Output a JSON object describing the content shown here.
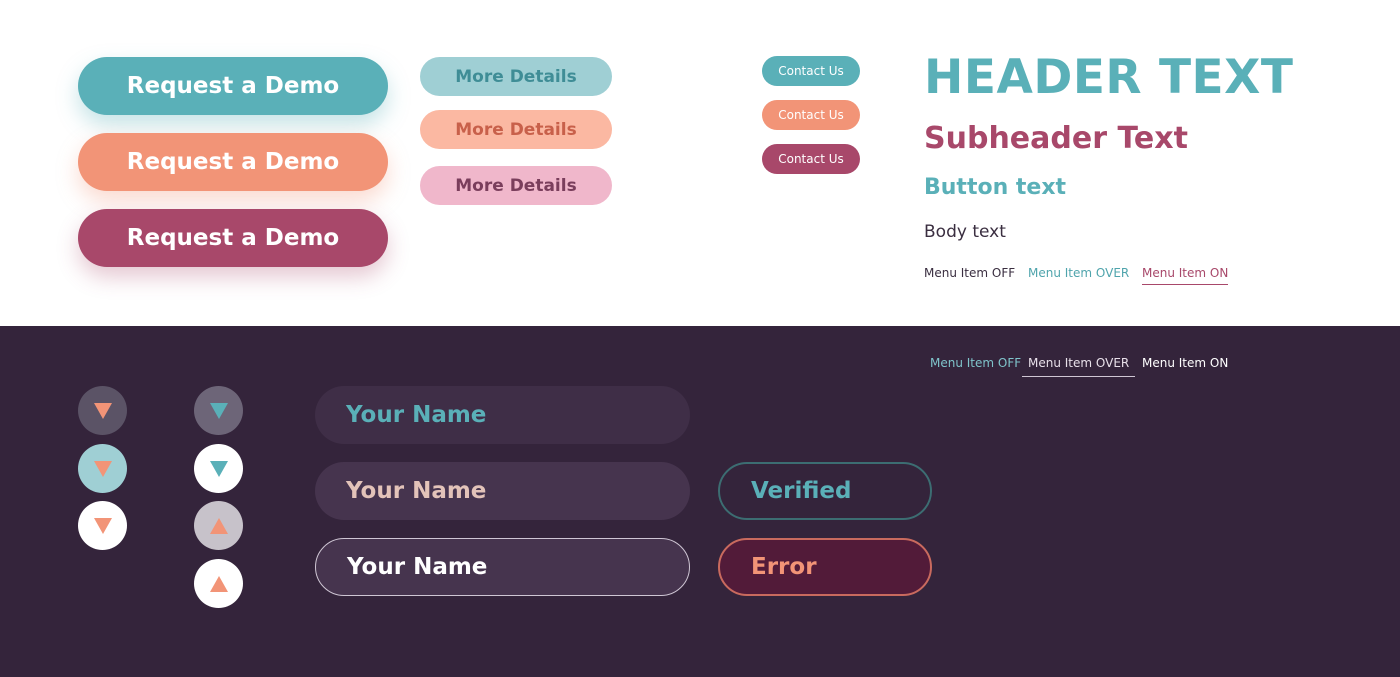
{
  "large_buttons": [
    {
      "label": "Request a Demo",
      "color": "#5ab0b8"
    },
    {
      "label": "Request a Demo",
      "color": "#f29477"
    },
    {
      "label": "Request a Demo",
      "color": "#a8486a"
    }
  ],
  "medium_buttons": [
    {
      "label": "More Details",
      "bg": "#9fcfd4",
      "text": "#3f8d96"
    },
    {
      "label": "More Details",
      "bg": "#fbb8a2",
      "text": "#c8604a"
    },
    {
      "label": "More Details",
      "bg": "#f0b7cb",
      "text": "#7a3e5c"
    }
  ],
  "small_buttons": [
    {
      "label": "Contact Us",
      "color": "#5ab0b8"
    },
    {
      "label": "Contact Us",
      "color": "#f29477"
    },
    {
      "label": "Contact Us",
      "color": "#a8486a"
    }
  ],
  "typography": {
    "header": "HEADER TEXT",
    "subheader": "Subheader Text",
    "button_text": "Button text",
    "body": "Body text"
  },
  "menu_light": {
    "off": "Menu Item OFF",
    "over": "Menu Item OVER",
    "on": "Menu Item ON"
  },
  "menu_dark": {
    "off": "Menu Item OFF",
    "over": "Menu Item OVER",
    "on": "Menu Item ON"
  },
  "arrow_icons": [
    "chevron-down-icon",
    "chevron-down-icon",
    "chevron-down-icon",
    "chevron-down-icon",
    "chevron-down-icon",
    "chevron-up-icon",
    "chevron-up-icon"
  ],
  "form_fields": [
    {
      "value": "Your Name",
      "state": "default"
    },
    {
      "value": "Your Name",
      "state": "hover"
    },
    {
      "value": "Your Name",
      "state": "focused"
    }
  ],
  "status_fields": {
    "verified": "Verified",
    "error": "Error"
  },
  "colors": {
    "teal": "#5ab0b8",
    "coral": "#f29477",
    "berry": "#a8486a",
    "dark_bg": "#34243b"
  }
}
